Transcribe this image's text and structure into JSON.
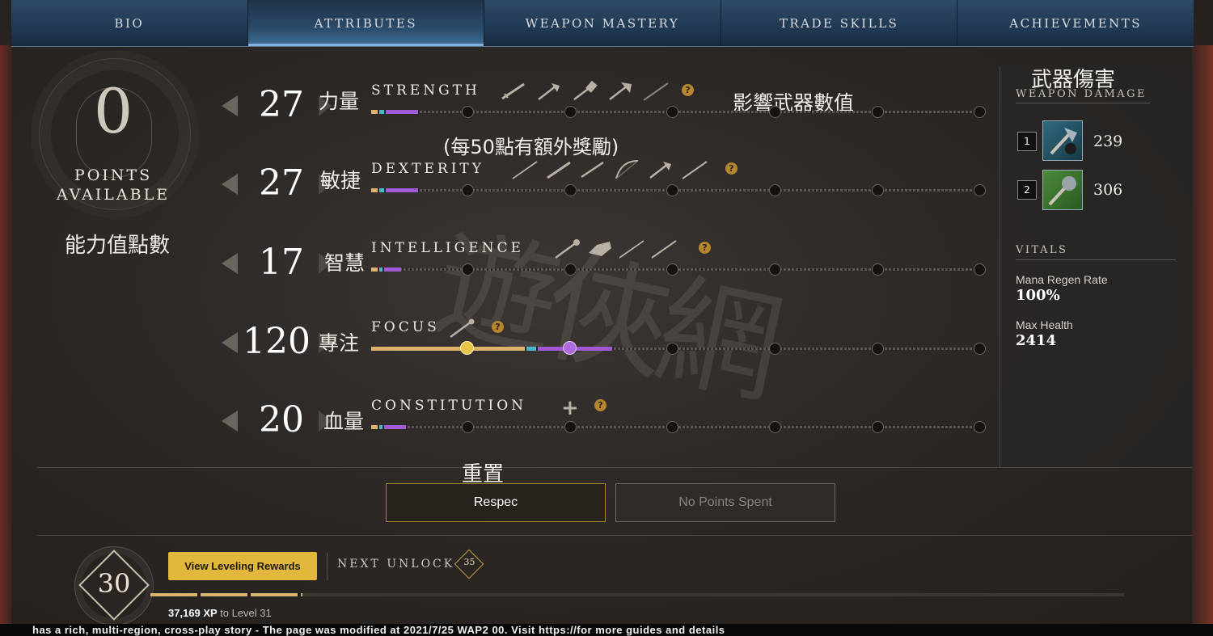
{
  "tabs": [
    "BIO",
    "ATTRIBUTES",
    "WEAPON MASTERY",
    "TRADE SKILLS",
    "ACHIEVEMENTS"
  ],
  "active_tab": "ATTRIBUTES",
  "points": {
    "value": "0",
    "label_line1": "POINTS",
    "label_line2": "AVAILABLE",
    "cn_label": "能力值點數"
  },
  "attributes": [
    {
      "value": "27",
      "cn": "力量",
      "name": "STRENGTH",
      "cn_note": "影響武器數值",
      "fill": 0.077
    },
    {
      "value": "27",
      "cn": "敏捷",
      "name": "DEXTERITY",
      "cn_note": "(每50點有額外獎勵)",
      "fill": 0.077
    },
    {
      "value": "17",
      "cn": "智慧",
      "name": "INTELLIGENCE",
      "fill": 0.049
    },
    {
      "value": "120",
      "cn": "專注",
      "name": "FOCUS",
      "fill": 0.4
    },
    {
      "value": "20",
      "cn": "血量",
      "name": "CONSTITUTION",
      "fill": 0.057
    }
  ],
  "weapon_damage": {
    "title_cn": "武器傷害",
    "title": "WEAPON DAMAGE",
    "slots": [
      {
        "slot": "1",
        "value": "239"
      },
      {
        "slot": "2",
        "value": "306"
      }
    ]
  },
  "vitals": {
    "title": "VITALS",
    "items": [
      {
        "label": "Mana Regen Rate",
        "value": "100%"
      },
      {
        "label": "Max Health",
        "value": "2414"
      }
    ]
  },
  "actions": {
    "respec_cn": "重置",
    "respec": "Respec",
    "no_points": "No Points Spent"
  },
  "level": {
    "current": "30",
    "rewards_button": "View Leveling Rewards",
    "next_unlock_label": "NEXT UNLOCK",
    "next_unlock": "35",
    "xp": "37,169 XP",
    "xp_suffix": "to Level 31",
    "xp_progress": 0.156
  },
  "watermark_text": "遊俠網",
  "footer_text": "has a rich, multi-region, cross-play story - The page was modified at 2021/7/25 WAP2 00. Visit https://for more guides and details",
  "colors": {
    "accent_gold": "#e2b83c",
    "focus_purple": "#a05ad8",
    "tab_blue": "#2e4a66"
  }
}
